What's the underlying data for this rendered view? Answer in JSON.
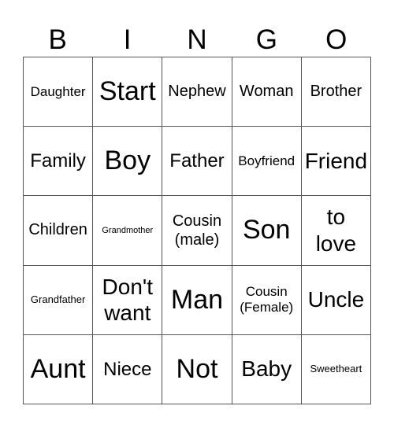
{
  "header": {
    "letters": [
      "B",
      "I",
      "N",
      "G",
      "O"
    ]
  },
  "grid": {
    "rows": [
      [
        "Daughter",
        "Start",
        "Nephew",
        "Woman",
        "Brother"
      ],
      [
        "Family",
        "Boy",
        "Father",
        "Boyfriend",
        "Friend"
      ],
      [
        "Children",
        "Grandmother",
        "Cousin\n(male)",
        "Son",
        "to\nlove"
      ],
      [
        "Grandfather",
        "Don't\nwant",
        "Man",
        "Cousin\n(Female)",
        "Uncle"
      ],
      [
        "Aunt",
        "Niece",
        "Not",
        "Baby",
        "Sweetheart"
      ]
    ]
  }
}
